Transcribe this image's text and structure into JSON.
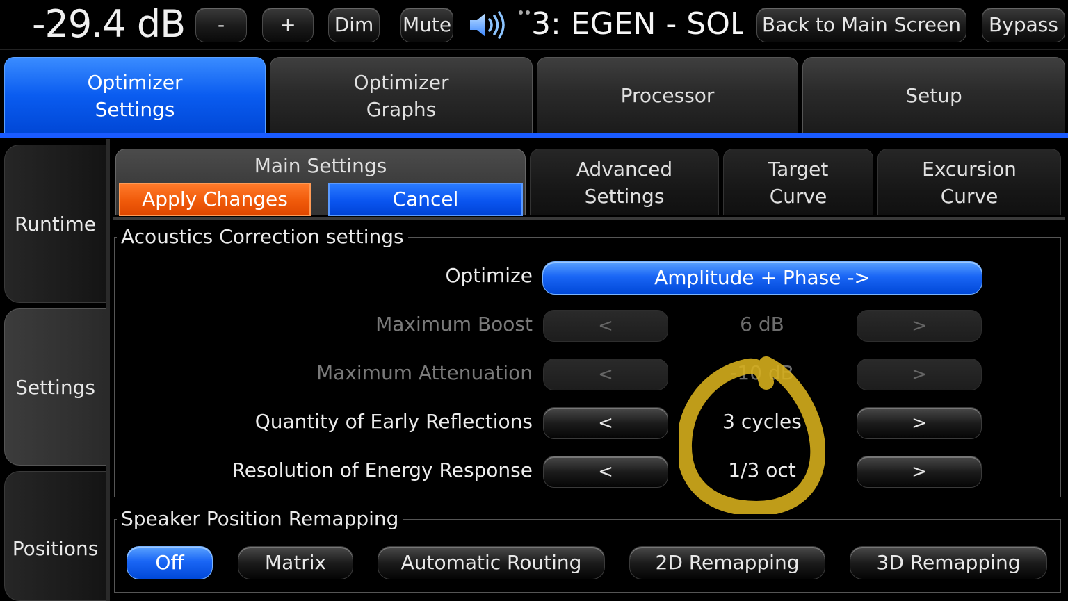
{
  "top_bar": {
    "volume": "-29.4 dB",
    "minus_label": "-",
    "plus_label": "+",
    "dim_label": "Dim",
    "mute_label": "Mute",
    "preset_name": "3: EGEN - SOL",
    "back_label": "Back to Main Screen",
    "bypass_label": "Bypass"
  },
  "main_tabs": [
    {
      "line1": "Optimizer",
      "line2": "Settings",
      "active": true
    },
    {
      "line1": "Optimizer",
      "line2": "Graphs",
      "active": false
    },
    {
      "line1": "Processor",
      "line2": "",
      "active": false
    },
    {
      "line1": "Setup",
      "line2": "",
      "active": false
    }
  ],
  "side_tabs": [
    {
      "label": "Runtime",
      "active": false
    },
    {
      "label": "Settings",
      "active": true
    },
    {
      "label": "Positions",
      "active": false
    }
  ],
  "sub_tabs": {
    "main_label": "Main Settings",
    "apply_label": "Apply Changes",
    "cancel_label": "Cancel",
    "advanced": {
      "line1": "Advanced",
      "line2": "Settings"
    },
    "target": {
      "line1": "Target",
      "line2": "Curve"
    },
    "excursion": {
      "line1": "Excursion",
      "line2": "Curve"
    }
  },
  "acoustics": {
    "title": "Acoustics Correction settings",
    "optimize_label": "Optimize",
    "optimize_value": "Amplitude + Phase ->",
    "rows": [
      {
        "label": "Maximum Boost",
        "value": "6 dB",
        "enabled": false
      },
      {
        "label": "Maximum Attenuation",
        "value": "-10 dB",
        "enabled": false
      },
      {
        "label": "Quantity of Early Reflections",
        "value": "3 cycles",
        "enabled": true
      },
      {
        "label": "Resolution of Energy Response",
        "value": "1/3 oct",
        "enabled": true
      }
    ],
    "prev_glyph": "<",
    "next_glyph": ">"
  },
  "remapping": {
    "title": "Speaker Position Remapping",
    "options": [
      {
        "label": "Off",
        "active": true
      },
      {
        "label": "Matrix",
        "active": false
      },
      {
        "label": "Automatic Routing",
        "active": false
      },
      {
        "label": "2D Remapping",
        "active": false
      },
      {
        "label": "3D Remapping",
        "active": false
      }
    ]
  },
  "icons": {
    "volume": "speaker-volume-icon",
    "annotation": "highlight-circle-annotation"
  },
  "colors": {
    "accent_blue": "#0a5cf0",
    "apply_orange": "#f05a0a",
    "annotation_yellow": "#d9b21c"
  }
}
